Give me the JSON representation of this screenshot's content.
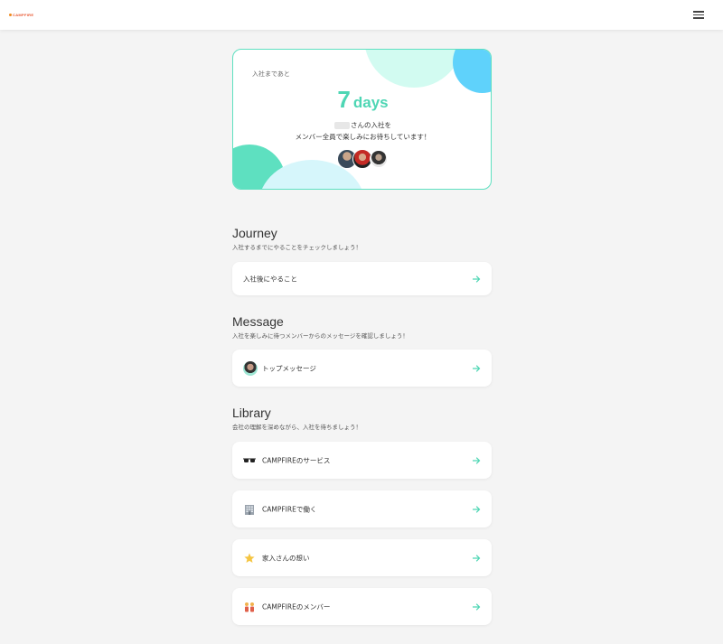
{
  "header": {
    "logo_text": "CAMPFIRE",
    "menu_icon": "hamburger-menu-icon"
  },
  "countdown": {
    "label": "入社まであと",
    "days_value": "7",
    "days_unit": "days",
    "message_line1": "さんの入社を",
    "message_line2": "メンバー全員で楽しみにお待ちしています！",
    "colors": {
      "accent": "#4ed6b4",
      "border": "#5ee0c0",
      "blue": "#5fd2fb"
    }
  },
  "journey": {
    "title": "Journey",
    "subtitle": "入社するまでにやることをチェックしましょう！",
    "items": [
      {
        "label": "入社後にやること"
      }
    ]
  },
  "message": {
    "title": "Message",
    "subtitle": "入社を楽しみに待つメンバーからのメッセージを確認しましょう！",
    "items": [
      {
        "label": "トップメッセージ"
      }
    ]
  },
  "library": {
    "title": "Library",
    "subtitle": "会社の理解を深めながら、入社を待ちましょう！",
    "items": [
      {
        "label": "CAMPFIREのサービス",
        "icon": "sunglasses-icon"
      },
      {
        "label": "CAMPFIREで働く",
        "icon": "office-building-icon"
      },
      {
        "label": "家入さんの想い",
        "icon": "star-icon"
      },
      {
        "label": "CAMPFIREのメンバー",
        "icon": "people-icon"
      }
    ]
  }
}
